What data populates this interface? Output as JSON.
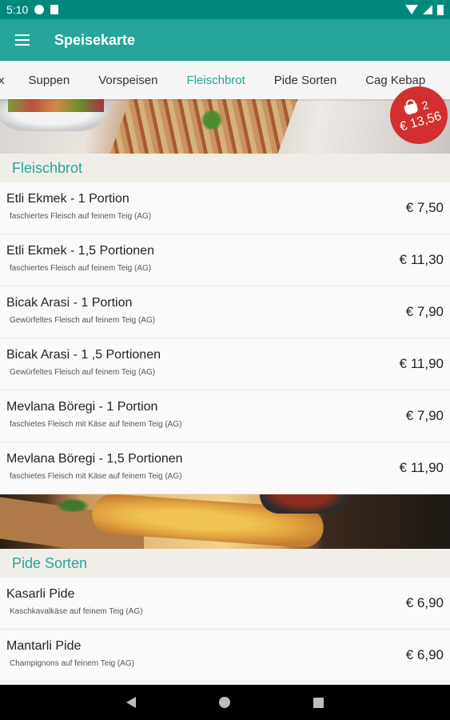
{
  "status_bar": {
    "time": "5:10"
  },
  "app_bar": {
    "title": "Speisekarte"
  },
  "tabs": [
    {
      "label": "x",
      "active": false
    },
    {
      "label": "Suppen",
      "active": false
    },
    {
      "label": "Vorspeisen",
      "active": false
    },
    {
      "label": "Fleischbrot",
      "active": true
    },
    {
      "label": "Pide Sorten",
      "active": false
    },
    {
      "label": "Cag Kebap",
      "active": false
    }
  ],
  "cart": {
    "count": "2",
    "total": "€ 13,56"
  },
  "sections": [
    {
      "title": "Fleischbrot",
      "items": [
        {
          "name": "Etli Ekmek - 1 Portion",
          "desc": "faschiertes Fleisch auf feinem Teig (AG)",
          "price": "€ 7,50"
        },
        {
          "name": "Etli Ekmek - 1,5 Portionen",
          "desc": "faschiertes Fleisch auf feinem Teig (AG)",
          "price": "€ 11,30"
        },
        {
          "name": "Bicak Arasi - 1 Portion",
          "desc": "Gewürfeltes Fleisch auf feinem Teig (AG)",
          "price": "€ 7,90"
        },
        {
          "name": "Bicak Arasi - 1 ,5 Portionen",
          "desc": "Gewürfeltes Fleisch auf feinem Teig (AG)",
          "price": "€ 11,90"
        },
        {
          "name": "Mevlana Böregi - 1 Portion",
          "desc": "faschietes Fleisch mit Käse  auf feinem Teig (AG)",
          "price": "€ 7,90"
        },
        {
          "name": "Mevlana Böregi - 1,5 Portionen",
          "desc": "faschietes Fleisch mit Käse  auf feinem Teig (AG)",
          "price": "€ 11,90"
        }
      ]
    },
    {
      "title": "Pide Sorten",
      "items": [
        {
          "name": "Kasarli Pide",
          "desc": "Kaschkavalkäse auf feinem Teig (AG)",
          "price": "€ 6,90"
        },
        {
          "name": "Mantarli Pide",
          "desc": "Champignons auf feinem Teig (AG)",
          "price": "€ 6,90"
        }
      ]
    }
  ],
  "colors": {
    "primary": "#26a69a",
    "primary_dark": "#00897b",
    "cart_badge": "#d32f2f",
    "section_bg": "#f1eeea"
  }
}
